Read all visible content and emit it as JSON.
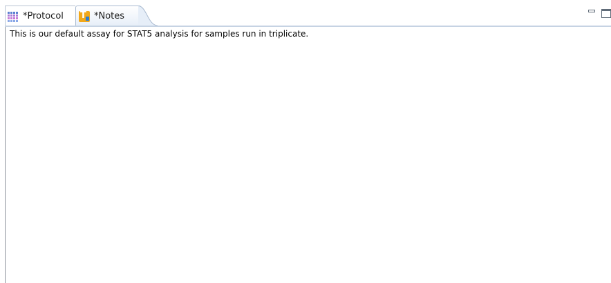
{
  "tabs": [
    {
      "label": "*Protocol",
      "icon": "grid-icon",
      "active": false
    },
    {
      "label": "*Notes",
      "icon": "notes-icon",
      "active": true
    }
  ],
  "window_controls": {
    "minimize_icon": "minimize-icon",
    "maximize_icon": "maximize-icon"
  },
  "notes": {
    "text": "This is our default assay for STAT5 analysis for samples run in triplicate."
  },
  "colors": {
    "tab_border": "#a8b9cf",
    "accent": "#f2a81a"
  }
}
